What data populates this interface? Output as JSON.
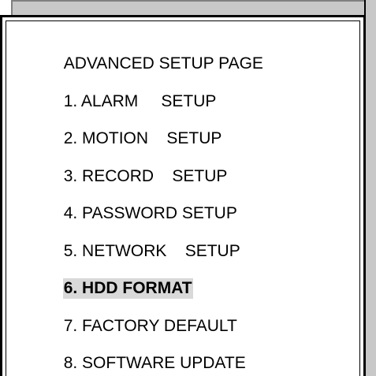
{
  "menu": {
    "title": "ADVANCED SETUP PAGE",
    "items": [
      {
        "label": "1. ALARM     SETUP",
        "selected": false
      },
      {
        "label": "2. MOTION    SETUP",
        "selected": false
      },
      {
        "label": "3. RECORD    SETUP",
        "selected": false
      },
      {
        "label": "4. PASSWORD SETUP",
        "selected": false
      },
      {
        "label": "5. NETWORK    SETUP",
        "selected": false
      },
      {
        "label": "6. HDD FORMAT",
        "selected": true
      },
      {
        "label": "7. FACTORY DEFAULT",
        "selected": false
      },
      {
        "label": "8. SOFTWARE UPDATE",
        "selected": false
      }
    ]
  },
  "colors": {
    "highlight": "#d9d9d9",
    "frame_shadow": "#c8c8c8",
    "text": "#000000"
  }
}
